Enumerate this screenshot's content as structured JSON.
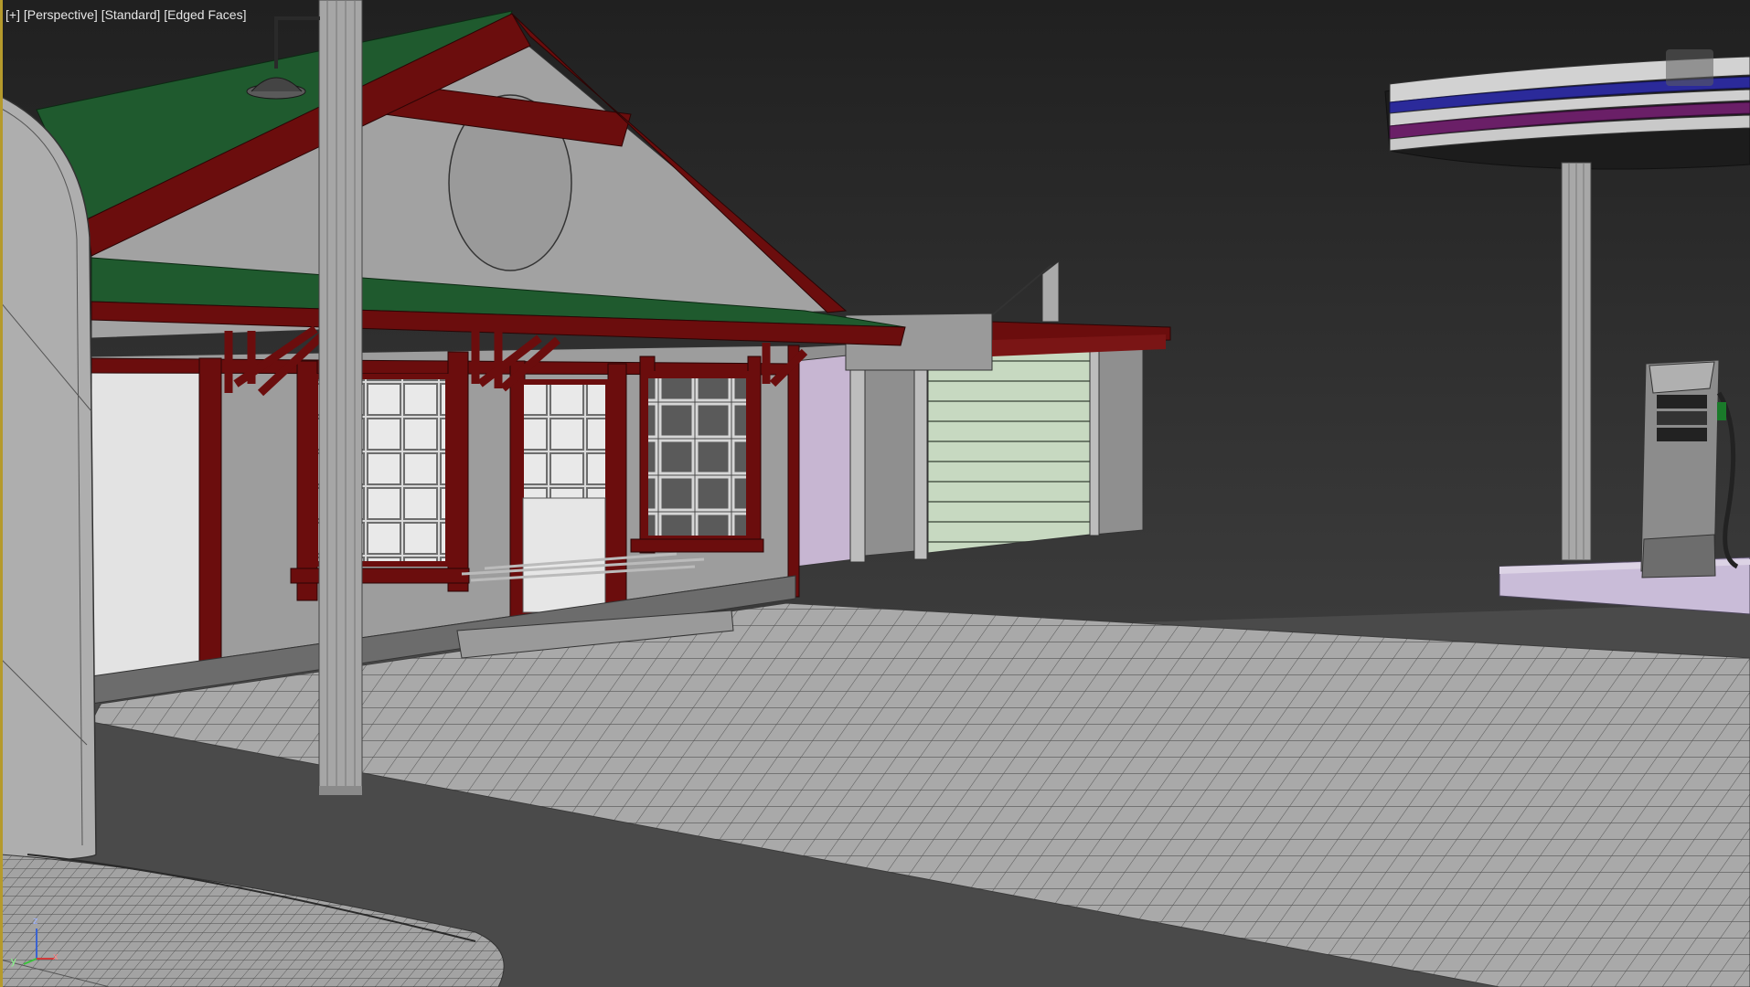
{
  "viewport": {
    "labels": [
      "[+]",
      "[Perspective]",
      "[Standard]",
      "[Edged Faces]"
    ]
  },
  "axes": {
    "x": "x",
    "y": "y",
    "z": "z"
  },
  "colors": {
    "background": "#2b2b2b",
    "roof": "#1f5a2e",
    "trim": "#6b0d0d",
    "wall": "#9c9c9c",
    "garage_door": "#c7d9c1",
    "pump_base": "#c9bcd8"
  }
}
